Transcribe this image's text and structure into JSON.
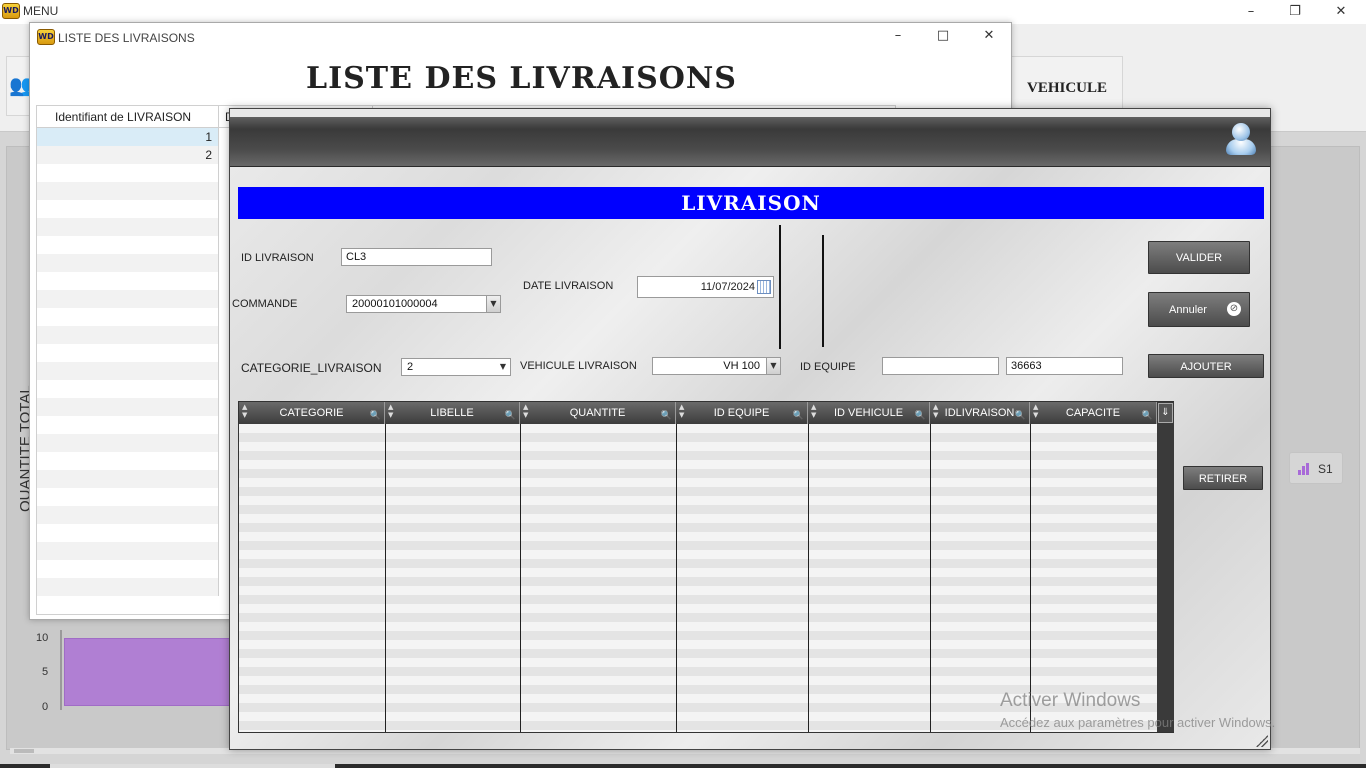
{
  "main": {
    "title": "MENU",
    "app_icon": "WD",
    "nav_vehicule": "VEHICULE",
    "chart_data": {
      "type": "bar",
      "ylabel": "QUANTITE TOTAL",
      "ylim": [
        0,
        10
      ],
      "yticks": [
        "10",
        "5",
        "0"
      ],
      "series": [
        {
          "name": "S1",
          "values": [
            10
          ]
        }
      ],
      "legend": "right"
    }
  },
  "liste": {
    "window_title": "LISTE DES LIVRAISONS",
    "heading": "LISTE DES LIVRAISONS",
    "columns": [
      "Identifiant de LIVRAISON",
      "D"
    ],
    "rows": [
      "1",
      "2"
    ]
  },
  "livraison": {
    "banner": "LIVRAISON",
    "id_livraison_label": "ID LIVRAISON",
    "id_livraison_value": "CL3",
    "commande_label": "COMMANDE",
    "commande_value": "20000101000004",
    "date_label": "DATE LIVRAISON",
    "date_value": "11/07/2024",
    "categorie_label": "CATEGORIE_LIVRAISON",
    "categorie_value": "2",
    "vehicule_label": "VEHICULE LIVRAISON",
    "vehicule_value": "VH 100",
    "id_equipe_label": "ID EQUIPE",
    "id_equipe_value1": "",
    "id_equipe_value2": "36663",
    "btn_valider": "VALIDER",
    "btn_annuler": "Annuler",
    "btn_ajouter": "AJOUTER",
    "btn_retirer": "RETIRER",
    "grid_columns": [
      "CATEGORIE",
      "LIBELLE",
      "QUANTITE",
      "ID EQUIPE",
      "ID VEHICULE",
      "IDLIVRAISON",
      "CAPACITE"
    ]
  },
  "watermark": {
    "line1": "Activer Windows",
    "line2": "Accédez aux paramètres pour activer Windows."
  }
}
